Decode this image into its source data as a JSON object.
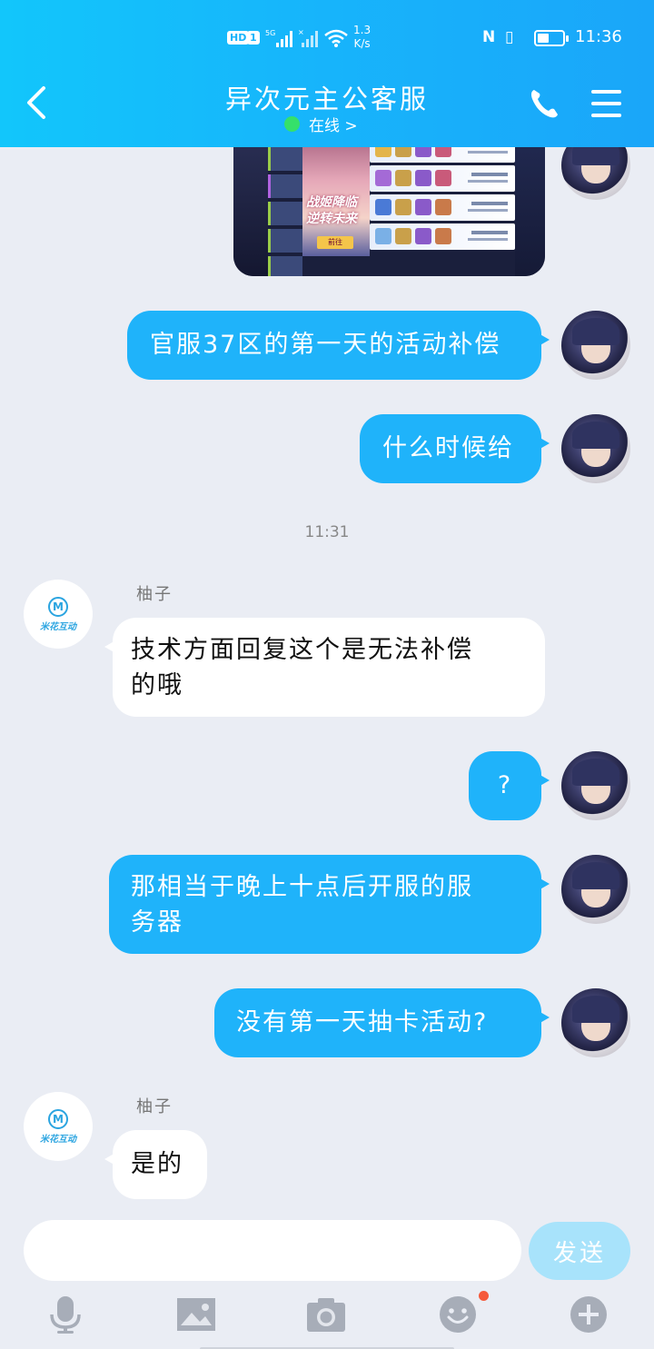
{
  "status_bar": {
    "hd_label": "HD",
    "hd_number": "1",
    "network": "5G",
    "speed_value": "1.3",
    "speed_unit": "K/s",
    "time": "11:36"
  },
  "header": {
    "title": "异次元主公客服",
    "status": "在线 >"
  },
  "messages": [
    {
      "side": "out",
      "type": "image"
    },
    {
      "side": "out",
      "text": "官服37区的第一天的活动补偿"
    },
    {
      "side": "out",
      "text": "什么时候给"
    },
    {
      "type": "time",
      "text": "11:31"
    },
    {
      "side": "in",
      "sender": "柚子",
      "line1": "技术方面回复这个是无法补偿",
      "line2": "的哦"
    },
    {
      "side": "out",
      "text": "?"
    },
    {
      "side": "out",
      "line1": "那相当于晚上十点后开服的服",
      "line2": "务器"
    },
    {
      "side": "out",
      "text": "没有第一天抽卡活动?"
    },
    {
      "side": "in",
      "sender": "柚子",
      "text": "是的"
    }
  ],
  "image_message": {
    "banner_line1": "战姬降临",
    "banner_line2": "逆转未来",
    "banner_button": "前往"
  },
  "cs_avatar": {
    "logo_letter": "M",
    "brand": "米花互动"
  },
  "input_bar": {
    "placeholder": "",
    "send_label": "发送"
  },
  "toolbar": {
    "icons": [
      "microphone-icon",
      "image-icon",
      "camera-icon",
      "emoji-icon",
      "plus-icon"
    ],
    "emoji_has_badge": true
  },
  "colors": {
    "header_gradient_start": "#12c6fb",
    "header_gradient_end": "#1aa6f9",
    "outgoing_bubble": "#1fb3fa",
    "incoming_bubble": "#ffffff",
    "background": "#eaedf4",
    "send_button_disabled": "#a8e3fb",
    "online_dot": "#35e06a",
    "badge": "#f55a3b"
  }
}
